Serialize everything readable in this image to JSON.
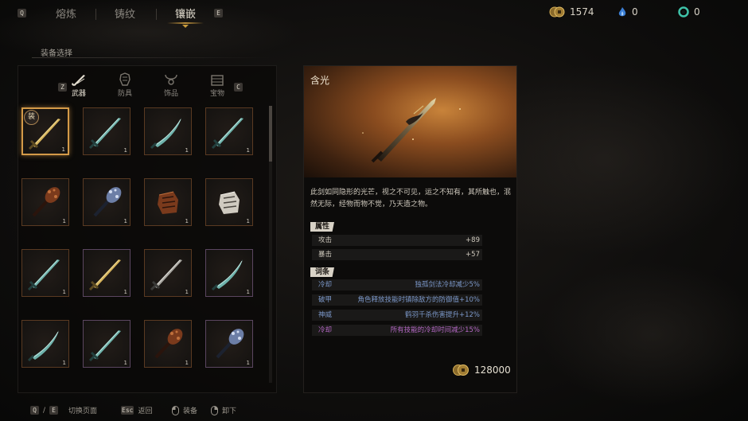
{
  "tabs": {
    "left_key": "Q",
    "right_key": "E",
    "items": [
      {
        "label": "熔炼"
      },
      {
        "label": "铸纹"
      },
      {
        "label": "镶嵌"
      }
    ],
    "active": "镶嵌"
  },
  "currencies": [
    {
      "icon": "coin-icon",
      "value": "1574",
      "color": "#c9a14a"
    },
    {
      "icon": "blue-flame-icon",
      "value": "0",
      "color": "#3b7fd6"
    },
    {
      "icon": "jade-ring-icon",
      "value": "0",
      "color": "#3ec2a8"
    }
  ],
  "section_label": "装备选择",
  "categories": {
    "left_key": "Z",
    "right_key": "C",
    "items": [
      {
        "label": "武器",
        "icon": "sword-icon"
      },
      {
        "label": "防具",
        "icon": "armor-icon"
      },
      {
        "label": "饰品",
        "icon": "necklace-icon"
      },
      {
        "label": "宝物",
        "icon": "treasure-icon"
      }
    ],
    "active": "武器"
  },
  "equipped_badge": "装",
  "slots": [
    {
      "icon": "golden-sword-icon",
      "count": "1",
      "tint": "gold"
    },
    {
      "icon": "jade-sword-icon",
      "count": "1",
      "tint": "teal"
    },
    {
      "icon": "curved-blade-icon",
      "count": "1",
      "tint": "teal"
    },
    {
      "icon": "jade-sword-icon",
      "count": "1",
      "tint": "teal"
    },
    {
      "icon": "spiked-club-icon",
      "count": "1",
      "tint": "rust"
    },
    {
      "icon": "crystal-mace-icon",
      "count": "1",
      "tint": "steel"
    },
    {
      "icon": "bronze-gauntlet-icon",
      "count": "1",
      "tint": "rust"
    },
    {
      "icon": "white-gauntlet-icon",
      "count": "1",
      "tint": "white"
    },
    {
      "icon": "jade-sword-icon",
      "count": "1",
      "tint": "teal"
    },
    {
      "icon": "golden-sword-icon",
      "count": "1",
      "tint": "gold"
    },
    {
      "icon": "silver-sword-icon",
      "count": "1",
      "tint": "silver"
    },
    {
      "icon": "curved-blade-icon",
      "count": "1",
      "tint": "teal"
    },
    {
      "icon": "curved-blade-icon",
      "count": "1",
      "tint": "teal"
    },
    {
      "icon": "jade-sword-icon",
      "count": "1",
      "tint": "teal"
    },
    {
      "icon": "spiked-club-icon",
      "count": "1",
      "tint": "rust"
    },
    {
      "icon": "crystal-mace-icon",
      "count": "1",
      "tint": "steel"
    }
  ],
  "detail": {
    "name": "含光",
    "description": "此剑如同隐形的光芒，视之不可见，运之不知有，其所触也，泯然无际，经物而物不觉，乃天造之物。",
    "attributes_header": "属性",
    "attributes": [
      {
        "name": "攻击",
        "value": "+89"
      },
      {
        "name": "暴击",
        "value": "+57"
      }
    ],
    "affixes_header": "词条",
    "affixes": [
      {
        "name": "冷却",
        "value": "独孤剑法冷却减少5%",
        "tier": "blue"
      },
      {
        "name": "破甲",
        "value": "角色释放技能时镇除敌方的防御值+10%",
        "tier": "blue"
      },
      {
        "name": "神威",
        "value": "鹤羽千杀伤害提升+12%",
        "tier": "blue"
      },
      {
        "name": "冷却",
        "value": "所有技能的冷却时间减少15%",
        "tier": "purple"
      }
    ],
    "price": "128000"
  },
  "footer": {
    "switch_keys": [
      "Q",
      "E"
    ],
    "switch_sep": "/",
    "switch_label": "切换页面",
    "back_key": "Esc",
    "back_label": "返回",
    "equip_label": "装备",
    "unequip_label": "卸下"
  }
}
